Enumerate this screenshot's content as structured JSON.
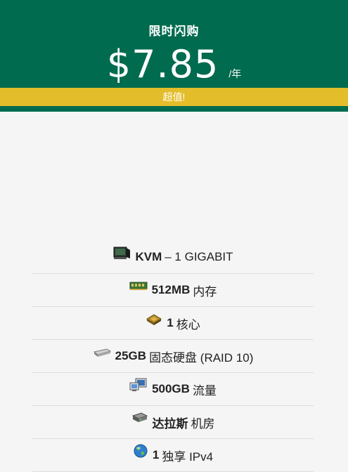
{
  "header": {
    "title": "限时闪购",
    "price": "$7.85",
    "unit": "/年",
    "badge": "超值!"
  },
  "features": [
    {
      "icon": "server-icon",
      "bold": "KVM",
      "text": "– 1 GIGABIT"
    },
    {
      "icon": "memory-icon",
      "bold": "512MB",
      "text": "内存"
    },
    {
      "icon": "cpu-icon",
      "bold": "1",
      "text": "核心"
    },
    {
      "icon": "disk-icon",
      "bold": "25GB",
      "text": "固态硬盘 (RAID 10)"
    },
    {
      "icon": "monitor-icon",
      "bold": "500GB",
      "text": "流量"
    },
    {
      "icon": "datacenter-icon",
      "bold": "达拉斯",
      "text": "机房"
    },
    {
      "icon": "globe-icon",
      "bold": "1",
      "text": "独享 IPv4"
    }
  ],
  "colors": {
    "header_bg": "#006b4f",
    "badge_bg": "#e3bd2a"
  }
}
